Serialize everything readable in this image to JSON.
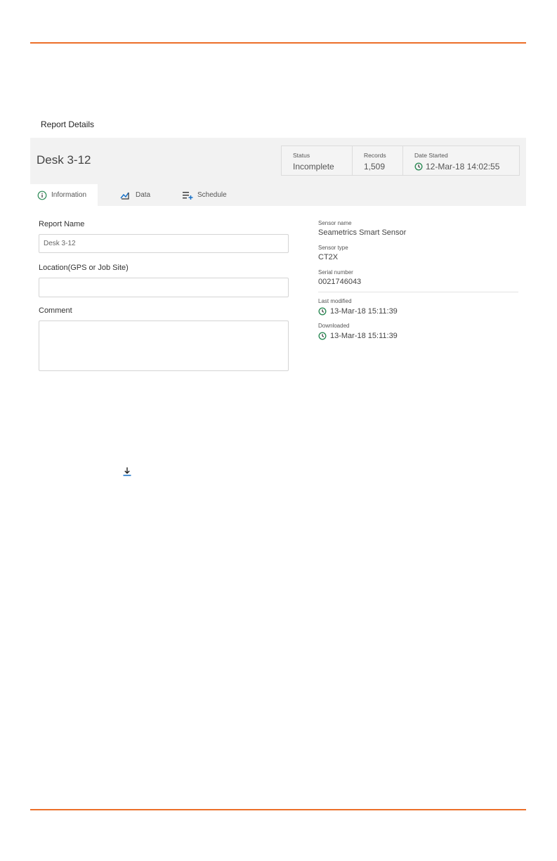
{
  "breadcrumb": "Report Details",
  "report": {
    "title": "Desk 3-12",
    "stats": {
      "status_label": "Status",
      "status_value": "Incomplete",
      "records_label": "Records",
      "records_value": "1,509",
      "started_label": "Date Started",
      "started_value": "12-Mar-18 14:02:55"
    }
  },
  "tabs": [
    {
      "label": "Information",
      "icon": "info-icon",
      "active": true
    },
    {
      "label": "Data",
      "icon": "chart-icon",
      "active": false
    },
    {
      "label": "Schedule",
      "icon": "schedule-icon",
      "active": false
    }
  ],
  "form": {
    "name_label": "Report Name",
    "name_value": "Desk 3-12",
    "location_label": "Location(GPS or Job Site)",
    "location_value": "",
    "comment_label": "Comment",
    "comment_value": ""
  },
  "sensor": {
    "name_label": "Sensor name",
    "name_value": "Seametrics Smart Sensor",
    "type_label": "Sensor type",
    "type_value": "CT2X",
    "serial_label": "Serial number",
    "serial_value": "0021746043",
    "modified_label": "Last modified",
    "modified_value": "13-Mar-18 15:11:39",
    "downloaded_label": "Downloaded",
    "downloaded_value": "13-Mar-18 15:11:39"
  },
  "colors": {
    "accent_rule": "#ec6f29",
    "clock": "#2e8b57",
    "icon_blue": "#1a73c8"
  }
}
